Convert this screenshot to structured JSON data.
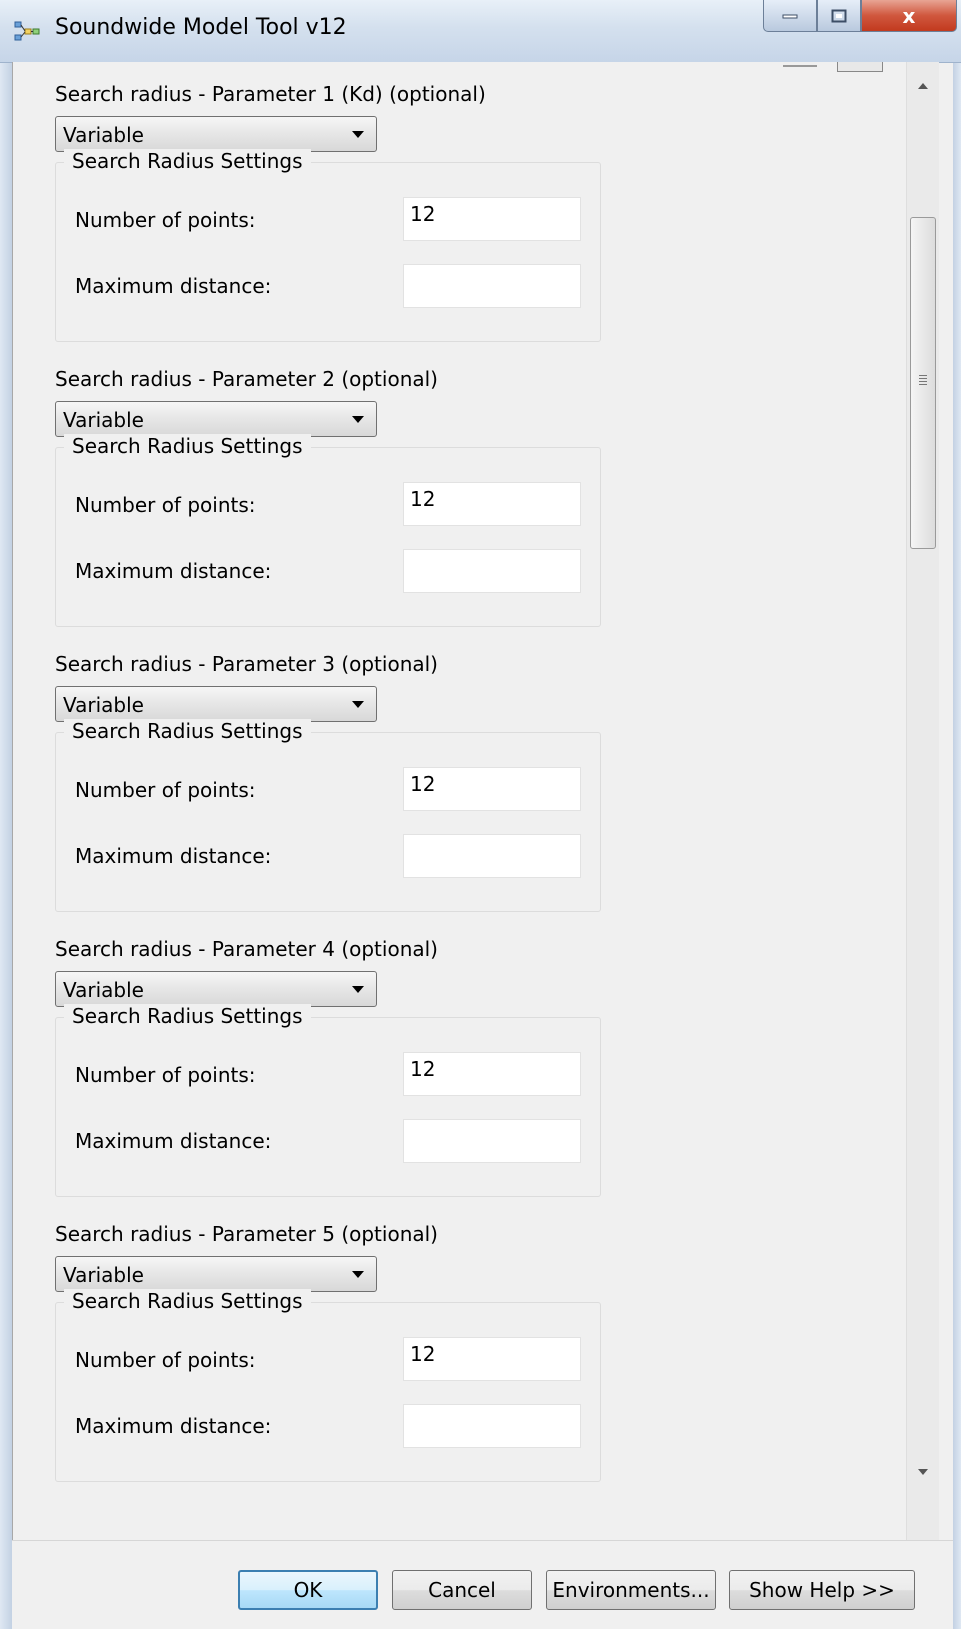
{
  "window": {
    "title": "Soundwide Model Tool v12",
    "close_glyph": "x"
  },
  "sections": [
    {
      "label": "Search radius - Parameter 1 (Kd) (optional)",
      "dropdown_value": "Variable",
      "group_title": "Search Radius Settings",
      "points_label": "Number of points:",
      "points_value": "12",
      "max_label": "Maximum distance:",
      "max_value": ""
    },
    {
      "label": "Search radius - Parameter 2 (optional)",
      "dropdown_value": "Variable",
      "group_title": "Search Radius Settings",
      "points_label": "Number of points:",
      "points_value": "12",
      "max_label": "Maximum distance:",
      "max_value": ""
    },
    {
      "label": "Search radius - Parameter 3 (optional)",
      "dropdown_value": "Variable",
      "group_title": "Search Radius Settings",
      "points_label": "Number of points:",
      "points_value": "12",
      "max_label": "Maximum distance:",
      "max_value": ""
    },
    {
      "label": "Search radius - Parameter 4 (optional)",
      "dropdown_value": "Variable",
      "group_title": "Search Radius Settings",
      "points_label": "Number of points:",
      "points_value": "12",
      "max_label": "Maximum distance:",
      "max_value": ""
    },
    {
      "label": "Search radius - Parameter 5 (optional)",
      "dropdown_value": "Variable",
      "group_title": "Search Radius Settings",
      "points_label": "Number of points:",
      "points_value": "12",
      "max_label": "Maximum distance:",
      "max_value": ""
    }
  ],
  "buttons": {
    "ok": "OK",
    "cancel": "Cancel",
    "environments": "Environments...",
    "show_help": "Show Help >>"
  },
  "icons": {
    "app": "model-tool-icon",
    "minimize": "minimize-icon",
    "maximize": "maximize-icon",
    "close": "close-icon",
    "dropdown": "chevron-down-icon",
    "scroll_up": "scroll-up-arrow-icon",
    "scroll_down": "scroll-down-arrow-icon",
    "scroll_grip": "grip-icon"
  },
  "colors": {
    "window_bg": "#f0f0f0",
    "close_button": "#c94c31",
    "default_button_border": "#3c7fb1"
  }
}
